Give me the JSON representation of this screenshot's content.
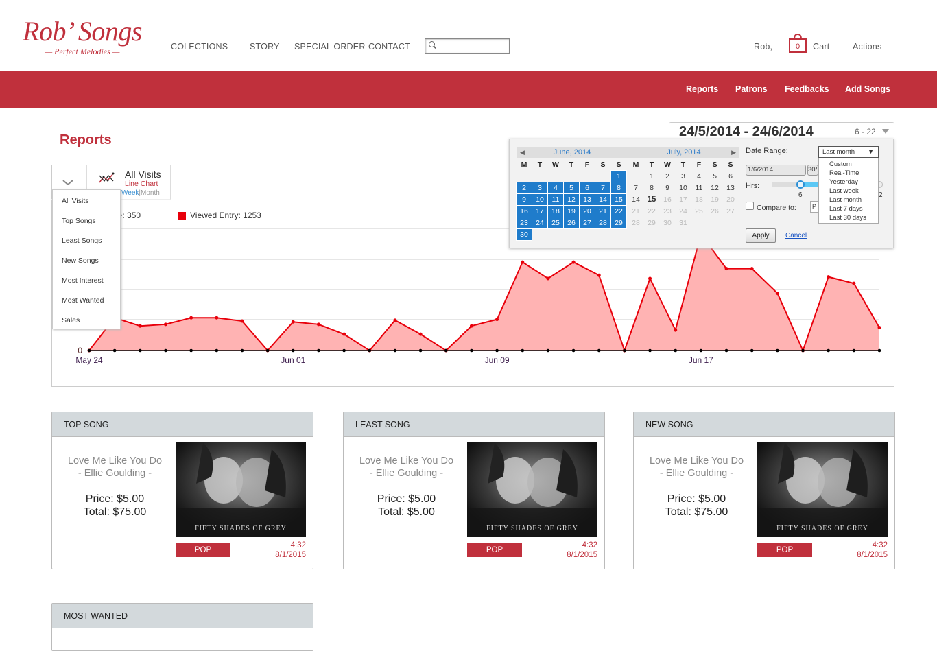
{
  "header": {
    "logo_title": "Rob’ Songs",
    "logo_subtitle": "— Perfect Melodies —",
    "nav": [
      "COLECTIONS -",
      "STORY",
      "SPECIAL ORDER",
      "CONTACT"
    ],
    "user": "Rob,",
    "cart_count": "0",
    "cart_label": "Cart",
    "actions": "Actions -"
  },
  "redbar": {
    "items": [
      "Reports",
      "Patrons",
      "Feedbacks",
      "Add Songs"
    ]
  },
  "page_title": "Reports",
  "range": {
    "dates": "24/5/2014 - 24/6/2014",
    "hours": "6 - 22"
  },
  "chart_toolbar": {
    "metric": "All Visits",
    "chart_type": "Line Chart",
    "week": "Week",
    "month": "Month",
    "legend_purchase": "ase: 350",
    "legend_viewed": "Viewed Entry: 1253"
  },
  "metric_menu": [
    "All Visits",
    "Top Songs",
    "Least Songs",
    "New Songs",
    "Most Interest",
    "Most Wanted",
    "Sales"
  ],
  "calendar": {
    "weekdays": [
      "M",
      "T",
      "W",
      "T",
      "F",
      "S",
      "S"
    ],
    "june": {
      "title": "June, 2014"
    },
    "july": {
      "title": "July, 2014"
    },
    "date_range_label": "Date Range:",
    "date_range_value": "Last month",
    "options": [
      "Custom",
      "Real-Time",
      "Yesterday",
      "Last week",
      "Last month",
      "Last 7 days",
      "Last 30 days"
    ],
    "start_date": "1/6/2014",
    "end_date": "30/",
    "hrs_label": "Hrs:",
    "hrs_value": "6",
    "hrs_max": "2",
    "compare_label": "Compare to:",
    "compare_value": "P",
    "apply": "Apply",
    "cancel": "Cancel"
  },
  "chart_data": {
    "type": "area",
    "x_labels": [
      "May 24",
      "Jun 01",
      "Jun 09",
      "Jun 17"
    ],
    "y_tick": "0",
    "values": [
      0,
      40,
      30,
      32,
      40,
      40,
      36,
      0,
      35,
      32,
      20,
      0,
      37,
      20,
      0,
      30,
      38,
      108,
      88,
      108,
      92,
      0,
      88,
      25,
      142,
      100,
      100,
      70,
      0,
      90,
      82,
      28
    ],
    "ylim": [
      0,
      150
    ],
    "color": "#e8000b",
    "fill": "#ffb3b3"
  },
  "cards": [
    {
      "title": "TOP SONG",
      "song": "Love Me Like You Do",
      "artist": "- Ellie Goulding -",
      "price": "Price: $5.00",
      "total": "Total: $75.00",
      "genre": "POP",
      "duration": "4:32",
      "date": "8/1/2015"
    },
    {
      "title": "LEAST SONG",
      "song": "Love Me Like You Do",
      "artist": "- Ellie Goulding -",
      "price": "Price: $5.00",
      "total": "Total: $5.00",
      "genre": "POP",
      "duration": "4:32",
      "date": "8/1/2015"
    },
    {
      "title": "NEW SONG",
      "song": "Love Me Like You Do",
      "artist": "- Ellie Goulding -",
      "price": "Price: $5.00",
      "total": "Total: $75.00",
      "genre": "POP",
      "duration": "4:32",
      "date": "8/1/2015"
    }
  ],
  "most_wanted": {
    "title": "MOST WANTED"
  },
  "album_caption": "FIFTY SHADES OF GREY",
  "colors": {
    "brand": "#c0303c",
    "calendar_selected": "#1f7ccb"
  }
}
